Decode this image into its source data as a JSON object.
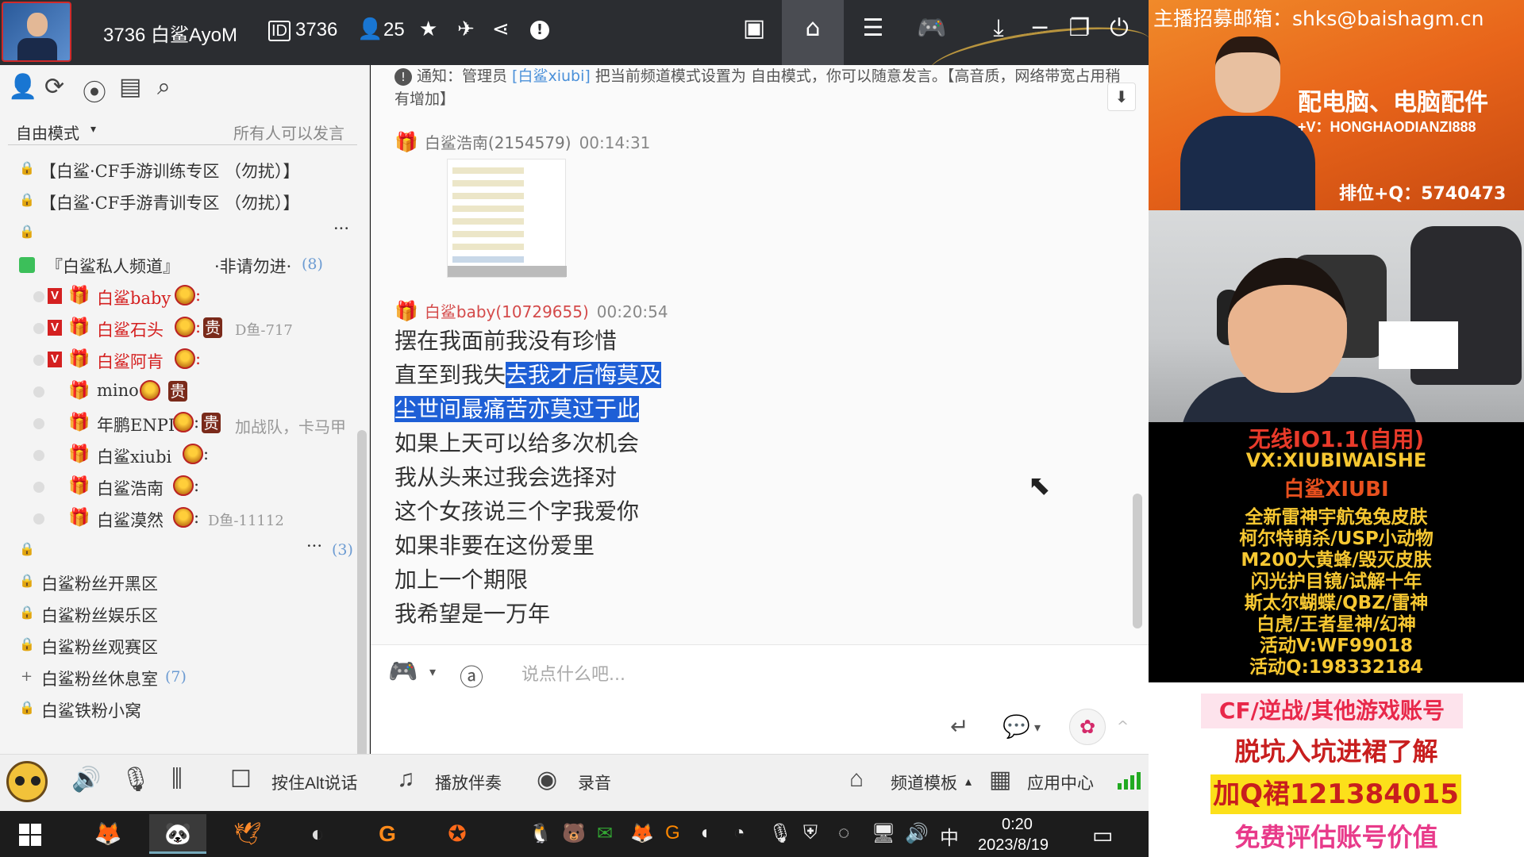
{
  "titlebar": {
    "channel_title": "3736 白鲨AyoM",
    "id_icon": "ID",
    "channel_id": "3736",
    "user_icon": "👤",
    "online_count": "25",
    "star_icon": "★",
    "plane_icon": "✈",
    "share_icon": "⋖",
    "info_icon": "!",
    "icons": {
      "video": "▣",
      "home": "⌂",
      "list": "☰",
      "gamepad": "🎮",
      "download": "⤓",
      "minimize": "─",
      "restore": "❐",
      "power": "⏻"
    }
  },
  "sidebar": {
    "tool_icons": [
      "👤",
      "⟳",
      "⦿",
      "▤",
      "⌕"
    ],
    "mode_label": "自由模式",
    "mode_caret": "▾",
    "mode_hint": "所有人可以发言",
    "lock_icon": "🔒",
    "plus_icon": "+",
    "channels_top": [
      {
        "name": "【白鲨·CF手游训练专区 （勿扰）】"
      },
      {
        "name": "【白鲨·CF手游青训专区 （勿扰）】"
      }
    ],
    "locked_ellipsis": "···",
    "private_channel": {
      "icon": "■",
      "name": "『白鲨私人频道』",
      "note": "·非请勿进·",
      "count": "(8)"
    },
    "members": [
      {
        "name": "白鲨baby",
        "v": "V",
        "suffix": ":",
        "sub": ""
      },
      {
        "name": "白鲨石头",
        "v": "V",
        "suffix": ":",
        "badge": "贵",
        "sub": "D鱼-717"
      },
      {
        "name": "白鲨阿肯",
        "v": "V",
        "suffix": ":",
        "sub": ""
      },
      {
        "name": "mino",
        "badge": "贵",
        "sub": ""
      },
      {
        "name": "年鹏ENPI",
        "suffix": ":",
        "badge": "贵",
        "sub": "加战队，卡马甲"
      },
      {
        "name": "白鲨xiubi",
        "suffix": ":",
        "sub": ""
      },
      {
        "name": "白鲨浩南",
        "suffix": ":",
        "sub": ""
      },
      {
        "name": "白鲨漠然",
        "suffix": ":",
        "sub": "D鱼-11112"
      }
    ],
    "group_ellipsis": "···",
    "group_count": "(3)",
    "fan_channels": [
      {
        "name": "白鲨粉丝开黑区"
      },
      {
        "name": "白鲨粉丝娱乐区"
      },
      {
        "name": "白鲨粉丝观赛区"
      },
      {
        "name": "白鲨粉丝休息室",
        "count": "(7)"
      },
      {
        "name": "白鲨铁粉小窝"
      }
    ]
  },
  "chat": {
    "notice_icon": "!",
    "notice_prefix": "通知：管理员 ",
    "notice_link": "[白鲨xiubi]",
    "notice_suffix": " 把当前频道模式设置为 自由模式，你可以随意发言。【高音质，网络带宽占用稍有增加】",
    "jump_icon": "⬇",
    "gift_icon": "🎁",
    "messages": [
      {
        "user": "白鲨浩南(2154579)",
        "time": "00:14:31"
      },
      {
        "user": "白鲨baby(10729655)",
        "time": "00:20:54"
      }
    ],
    "lyrics": [
      "摆在我面前我没有珍惜",
      "直至到我失",
      "去我才后悔莫及",
      "尘世间最痛苦亦莫过于此",
      "如果上天可以给多次机会",
      "我从头来过我会选择对",
      "这个女孩说三个字我爱你",
      "如果非要在这份爱里",
      "加上一个期限",
      "我希望是一万年"
    ],
    "cursor_icon": "⬉"
  },
  "input": {
    "game_icon": "🎮",
    "caret": "▾",
    "translate_icon": "ⓐ",
    "placeholder": "说点什么吧...",
    "enter_icon": "↵",
    "bubble_icon": "💬",
    "bubble_caret": "▾",
    "flower_icon": "✿",
    "up_icon": "^"
  },
  "bottombar": {
    "volume_icon": "🔊",
    "mic_icon": "🎙",
    "mixer_icon": "⫼",
    "ptt_icon": "☐",
    "ptt_label": "按住Alt说话",
    "music_icon": "♫",
    "music_label": "播放伴奏",
    "record_icon": "◉",
    "record_label": "录音",
    "template_icon": "⌂",
    "template_label": "频道模板",
    "template_caret": "▴",
    "apps_icon": "▦",
    "apps_label": "应用中心"
  },
  "taskbar": {
    "apps": [
      "🦊",
      "🐼",
      "🕊",
      "◐",
      "G",
      "✪"
    ],
    "tray_icons": [
      "🐧",
      "🐻",
      "✉",
      "🦊",
      "G",
      "◖",
      "◔",
      "🎙",
      "⛨",
      "◌",
      "🖥",
      "🔊",
      "中"
    ],
    "time": "0:20",
    "date": "2023/8/19",
    "notif_icon": "▭"
  },
  "overlay": {
    "recruit": "主播招募邮箱：shks@baishagm.cn",
    "ad_line1": "配电脑、电脑配件",
    "ad_line2": "+V：HONGHAODIANZI888",
    "ad_line3": "排位+Q：5740473",
    "promo_red1": "无线IO1.1(自用)",
    "promo_yellow1": "VX:XIUBIWAISHE",
    "promo_red2": "白鲨XIUBI",
    "promo_lines": [
      "全新雷神宇航兔兔皮肤",
      "柯尔特萌杀/USP小动物",
      "M200大黄蜂/毁灭皮肤",
      "闪光护目镜/试解十年",
      "斯太尔蝴蝶/QBZ/雷神",
      "白虎/王者星神/幻神",
      "活动V:WF99018",
      "活动Q:198332184"
    ],
    "acc1": "CF/逆战/其他游戏账号",
    "acc2": "脱坑入坑进裙了解",
    "acc3": "加Q裙121384015",
    "acc4": "免费评估账号价值"
  }
}
